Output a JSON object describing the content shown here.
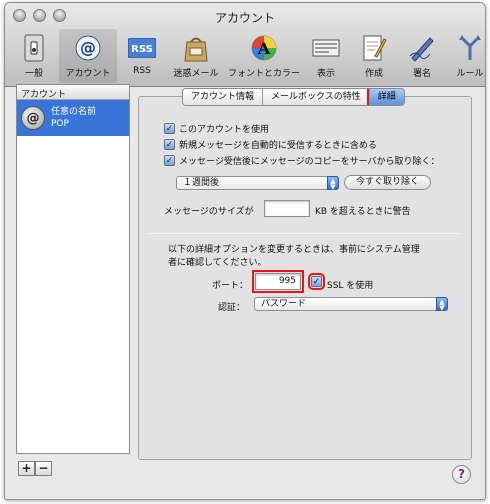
{
  "window": {
    "title": "アカウント"
  },
  "toolbar": {
    "items": [
      {
        "label": "一般",
        "icon": "general-switch-icon"
      },
      {
        "label": "アカウント",
        "icon": "at-sign-icon"
      },
      {
        "label": "RSS",
        "icon": "rss-icon"
      },
      {
        "label": "迷惑メール",
        "icon": "junk-mail-bag-icon"
      },
      {
        "label": "フォントとカラー",
        "icon": "font-color-icon"
      },
      {
        "label": "表示",
        "icon": "view-icon"
      },
      {
        "label": "作成",
        "icon": "compose-icon"
      },
      {
        "label": "署名",
        "icon": "signature-pen-icon"
      },
      {
        "label": "ルール",
        "icon": "rules-icon"
      }
    ],
    "selected": "アカウント"
  },
  "accounts": {
    "header": "アカウント",
    "items": [
      {
        "name": "任意の名前",
        "type": "POP"
      }
    ],
    "add_label": "+",
    "remove_label": "−"
  },
  "tabs": [
    {
      "label": "アカウント情報",
      "active": false
    },
    {
      "label": "メールボックスの特性",
      "active": false
    },
    {
      "label": "詳細",
      "active": true
    }
  ],
  "options": {
    "enable_account": "このアカウントを使用",
    "include_auto_check": "新規メッセージを自動的に受信するときに含める",
    "remove_copy": "メッセージ受信後にメッセージのコピーをサーバから取り除く："
  },
  "remove_after": {
    "value": "１週間後",
    "button": "今すぐ取り除く"
  },
  "message_size": {
    "label_before": "メッセージのサイズが",
    "value": "",
    "label_after": "KB を超えるときに警告"
  },
  "notice": {
    "line1": "以下の詳細オプションを変更するときは、事前にシステム管理",
    "line2": "者に確認してください。"
  },
  "port": {
    "label": "ポート：",
    "value": "995",
    "ssl_label": "SSL を使用"
  },
  "auth": {
    "label": "認証：",
    "value": "パスワード"
  },
  "help_label": "?"
}
